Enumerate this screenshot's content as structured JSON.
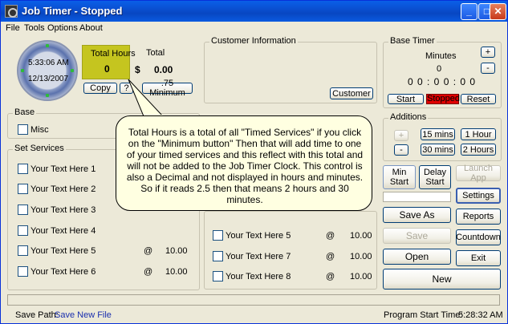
{
  "window": {
    "title": "Job Timer - Stopped"
  },
  "menu": [
    "File",
    "Tools",
    "Options",
    "About"
  ],
  "clock": {
    "time": "5:33:06 AM",
    "date": "12/13/2007"
  },
  "total_hours": {
    "label": "Total Hours",
    "value": "0"
  },
  "total": {
    "label": "Total",
    "currency": "$",
    "value": "0.00"
  },
  "buttons": {
    "copy": "Copy",
    "help": "?",
    "minimum": ".75 Minimum",
    "customer": "Customer"
  },
  "customer_info": {
    "title": "Customer Information"
  },
  "base_timer": {
    "title": "Base Timer",
    "minutes_label": "Minutes",
    "minutes_value": "0",
    "display": "0 0 : 0 0 : 0 0",
    "plus": "+",
    "minus": "-",
    "start": "Start",
    "status": "Stopped",
    "reset": "Reset"
  },
  "base": {
    "title": "Base",
    "item": "Misc"
  },
  "additions": {
    "title": "Additions",
    "plus": "+",
    "minus": "-",
    "b15": "15 mins",
    "b30": "30 mins",
    "b1h": "1 Hour",
    "b2h": "2 Hours"
  },
  "controls": {
    "min_start": "Min Start",
    "delay_start": "Delay Start",
    "launch_app": "Launch App",
    "settings": "Settings",
    "save_as": "Save As",
    "reports": "Reports",
    "save": "Save",
    "countdown": "Countdown",
    "open": "Open",
    "exit": "Exit",
    "new": "New"
  },
  "set_services": {
    "title": "Set Services",
    "items": [
      "Your Text Here 1",
      "Your Text Here 2",
      "Your Text Here 3",
      "Your Text Here 4",
      "Your Text Here 5",
      "Your Text Here 6"
    ],
    "at": "@",
    "rates": [
      "10.00",
      "10.00"
    ]
  },
  "timed_services": {
    "items": [
      "Your Text Here 5",
      "Your Text Here 7",
      "Your Text Here 8"
    ],
    "at": "@",
    "rates": [
      "10.00",
      "10.00",
      "10.00"
    ]
  },
  "tooltip": "Total Hours is a total of all \"Timed Services\" if you click on the \"Minimum button\" Then that will add time to one of your timed services and this reflect with this total and will not be added to the Job Timer Clock. This control is also a Decimal and not displayed in hours and minutes. So if it reads 2.5 then that means 2 hours and 30 minutes.",
  "status": {
    "save_path_label": "Save Path:",
    "save_path_value": "Save New File",
    "program_start_label": "Program Start Time:",
    "program_start_value": "5:28:32 AM"
  }
}
